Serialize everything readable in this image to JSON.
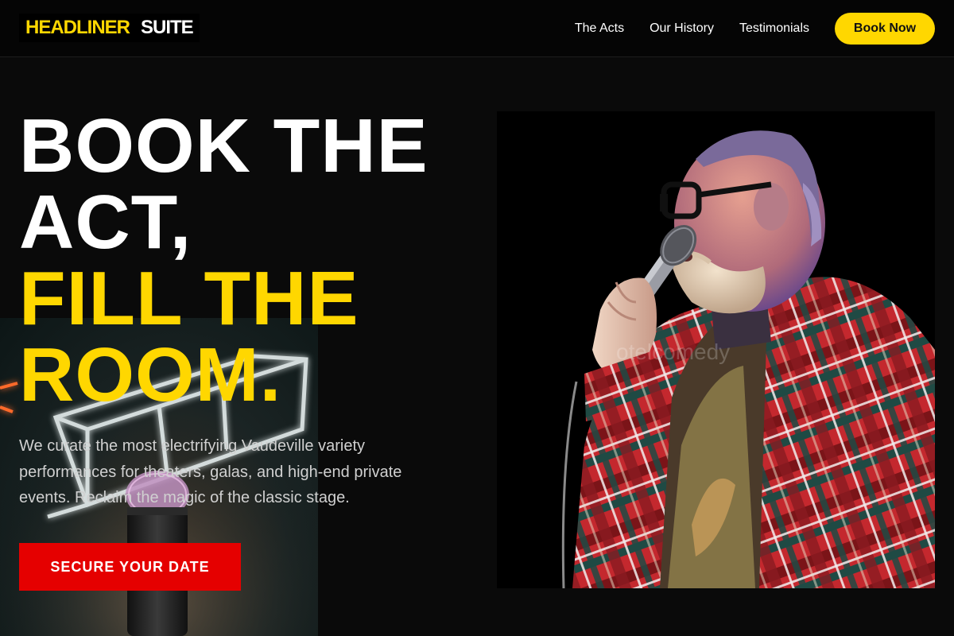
{
  "header": {
    "logo_part1": "HEADLINER",
    "logo_part2": "SUITE",
    "nav": [
      "The Acts",
      "Our History",
      "Testimonials"
    ],
    "cta": "Book Now"
  },
  "hero": {
    "title_line1": "BOOK THE",
    "title_line2": "ACT,",
    "title_line3": "FILL THE",
    "title_line4": "ROOM.",
    "description": "We curate the most electrifying Vaudeville variety performances for theaters, galas, and high-end private events. Reclaim the magic of the classic stage.",
    "cta": "SECURE YOUR DATE"
  },
  "image": {
    "watermark": "otelcomedy"
  },
  "colors": {
    "accent": "#ffd700",
    "cta_red": "#e50000",
    "background": "#0a0a0a"
  }
}
